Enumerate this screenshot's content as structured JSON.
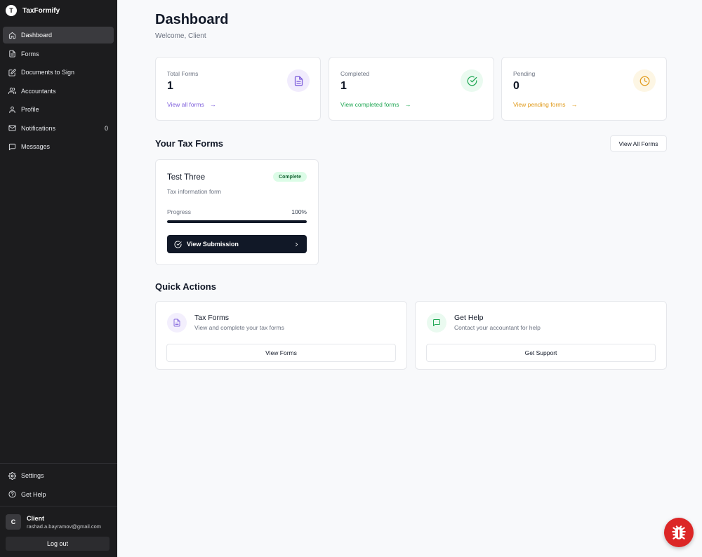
{
  "app": {
    "logo_letter": "T",
    "name": "TaxFormify"
  },
  "sidebar": {
    "items": [
      {
        "label": "Dashboard",
        "icon": "home-icon",
        "active": true
      },
      {
        "label": "Forms",
        "icon": "file-icon"
      },
      {
        "label": "Documents to Sign",
        "icon": "pen-square-icon"
      },
      {
        "label": "Accountants",
        "icon": "users-icon"
      },
      {
        "label": "Profile",
        "icon": "user-icon"
      },
      {
        "label": "Notifications",
        "icon": "mail-icon",
        "count": "0"
      },
      {
        "label": "Messages",
        "icon": "message-icon"
      }
    ],
    "bottom": [
      {
        "label": "Settings",
        "icon": "gear-icon"
      },
      {
        "label": "Get Help",
        "icon": "help-circle-icon"
      }
    ],
    "user": {
      "initial": "C",
      "name": "Client",
      "email": "rashad.a.bayramov@gmail.com"
    },
    "logout_label": "Log out"
  },
  "header": {
    "title": "Dashboard",
    "subtitle": "Welcome, Client"
  },
  "stats": [
    {
      "label": "Total Forms",
      "value": "1",
      "link": "View all forms",
      "color": "#7c5cdb",
      "icon_bg": "#f1ecfd",
      "icon": "file-icon"
    },
    {
      "label": "Completed",
      "value": "1",
      "link": "View completed forms",
      "color": "#22a855",
      "icon_bg": "#eafaf0",
      "icon": "check-circle-icon"
    },
    {
      "label": "Pending",
      "value": "0",
      "link": "View pending forms",
      "color": "#e09a1a",
      "icon_bg": "#fdf6e4",
      "icon": "clock-icon"
    }
  ],
  "tax_forms": {
    "title": "Your Tax Forms",
    "view_all_label": "View All Forms",
    "forms": [
      {
        "title": "Test Three",
        "status": "Complete",
        "description": "Tax information form",
        "progress_label": "Progress",
        "progress_text": "100%",
        "progress": 1.0,
        "button_label": "View Submission"
      }
    ]
  },
  "quick_actions": {
    "title": "Quick Actions",
    "items": [
      {
        "title": "Tax Forms",
        "description": "View and complete your tax forms",
        "button_label": "View Forms",
        "icon": "file-icon",
        "color": "#8b6fe0",
        "icon_bg": "#f3effd"
      },
      {
        "title": "Get Help",
        "description": "Contact your accountant for help",
        "button_label": "Get Support",
        "icon": "message-icon",
        "color": "#22a855",
        "icon_bg": "#eafaf0"
      }
    ]
  },
  "colors": {
    "sidebar_bg": "#1c1c1e",
    "primary": "#111827",
    "bug_button": "#dc2626"
  }
}
